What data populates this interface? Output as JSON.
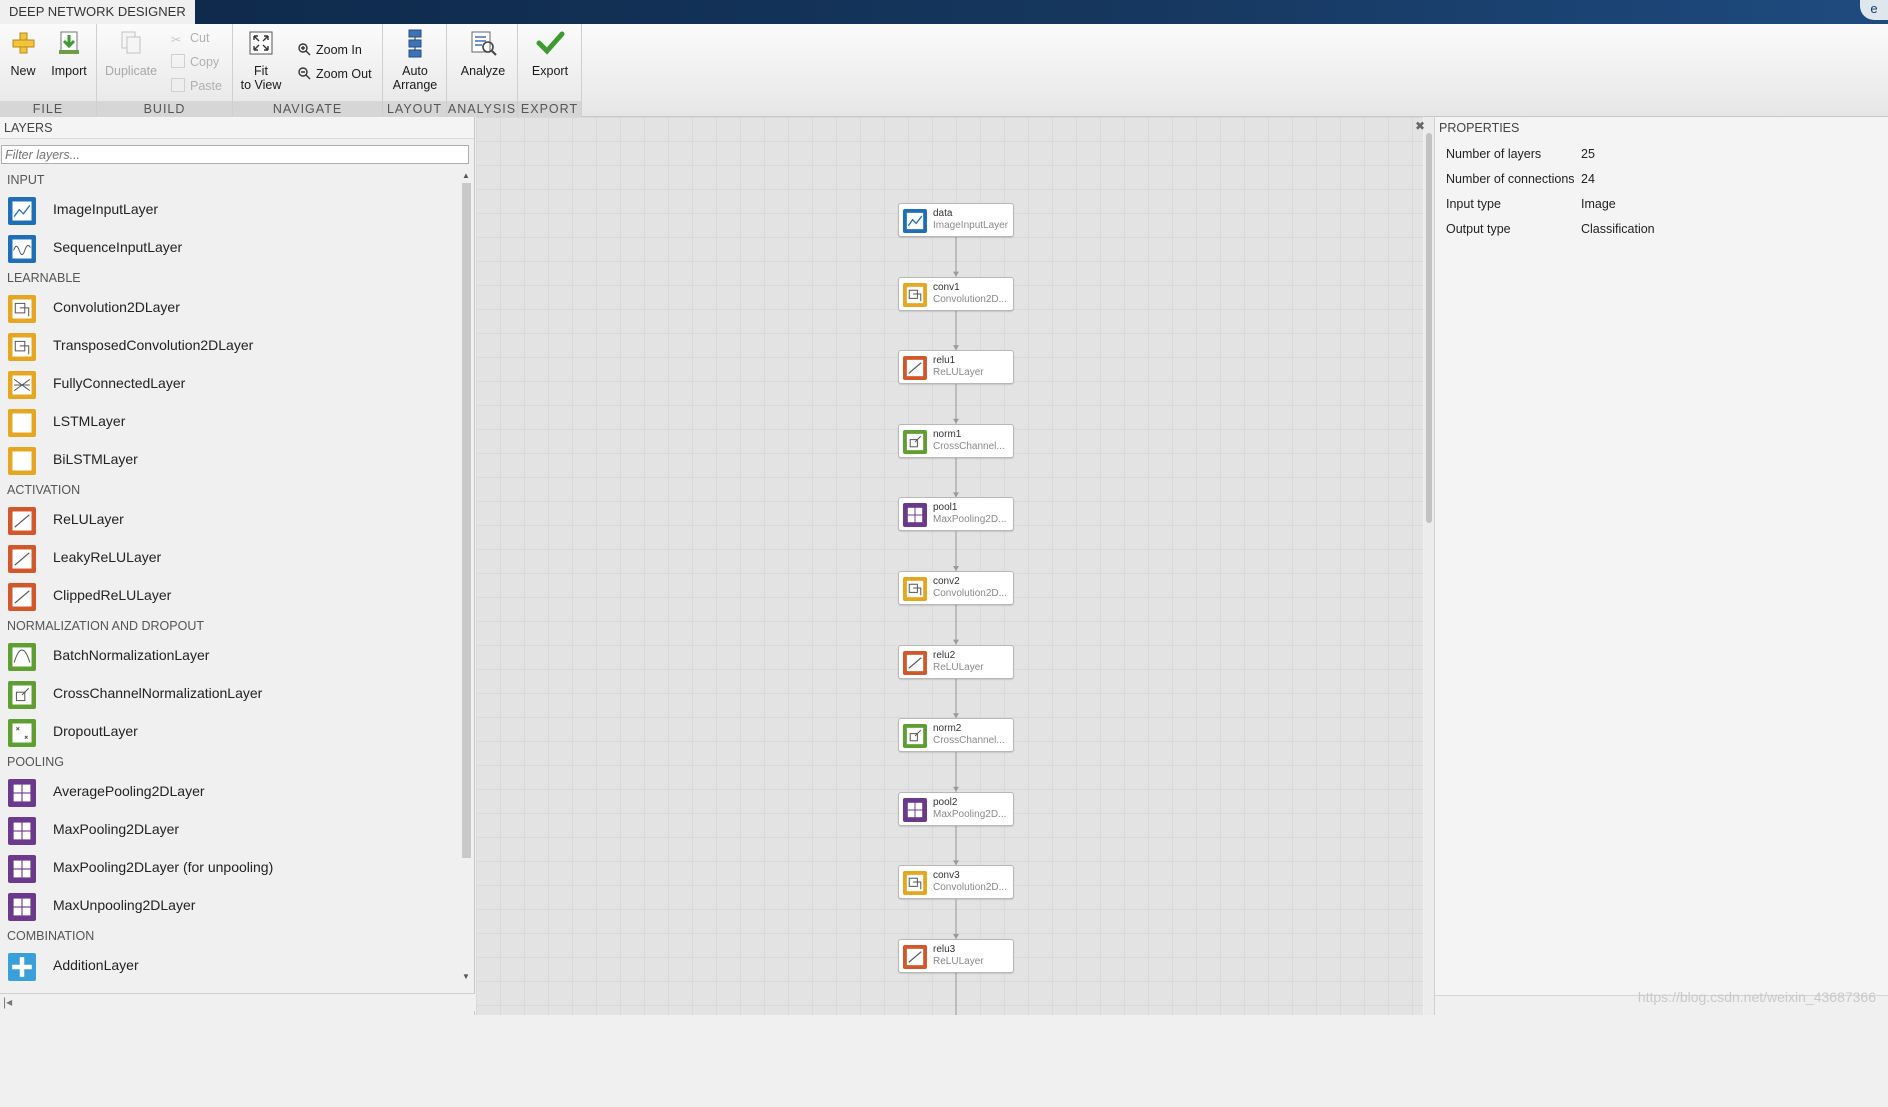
{
  "app": {
    "title": "DEEP NETWORK DESIGNER"
  },
  "ribbon": {
    "groups": {
      "file": "FILE",
      "build": "BUILD",
      "navigate": "NAVIGATE",
      "layout": "LAYOUT",
      "analysis": "ANALYSIS",
      "export": "EXPORT"
    },
    "buttons": {
      "new": "New",
      "import": "Import",
      "duplicate": "Duplicate",
      "cut": "Cut",
      "copy": "Copy",
      "paste": "Paste",
      "fit_line1": "Fit",
      "fit_line2": "to View",
      "zoom_in": "Zoom In",
      "zoom_out": "Zoom Out",
      "auto_line1": "Auto",
      "auto_line2": "Arrange",
      "analyze": "Analyze",
      "export": "Export"
    }
  },
  "layers_panel": {
    "header": "LAYERS",
    "filter_placeholder": "Filter layers...",
    "categories": [
      {
        "name": "INPUT",
        "items": [
          {
            "label": "ImageInputLayer",
            "icon": "image-input-icon"
          },
          {
            "label": "SequenceInputLayer",
            "icon": "sequence-input-icon"
          }
        ]
      },
      {
        "name": "LEARNABLE",
        "items": [
          {
            "label": "Convolution2DLayer",
            "icon": "convolution-icon"
          },
          {
            "label": "TransposedConvolution2DLayer",
            "icon": "transposed-convolution-icon"
          },
          {
            "label": "FullyConnectedLayer",
            "icon": "fully-connected-icon"
          },
          {
            "label": "LSTMLayer",
            "icon": "lstm-icon"
          },
          {
            "label": "BiLSTMLayer",
            "icon": "bilstm-icon"
          }
        ]
      },
      {
        "name": "ACTIVATION",
        "items": [
          {
            "label": "ReLULayer",
            "icon": "relu-icon"
          },
          {
            "label": "LeakyReLULayer",
            "icon": "leaky-relu-icon"
          },
          {
            "label": "ClippedReLULayer",
            "icon": "clipped-relu-icon"
          }
        ]
      },
      {
        "name": "NORMALIZATION AND DROPOUT",
        "items": [
          {
            "label": "BatchNormalizationLayer",
            "icon": "batch-norm-icon"
          },
          {
            "label": "CrossChannelNormalizationLayer",
            "icon": "cross-channel-norm-icon"
          },
          {
            "label": "DropoutLayer",
            "icon": "dropout-icon"
          }
        ]
      },
      {
        "name": "POOLING",
        "items": [
          {
            "label": "AveragePooling2DLayer",
            "icon": "average-pooling-icon"
          },
          {
            "label": "MaxPooling2DLayer",
            "icon": "max-pooling-icon"
          },
          {
            "label": "MaxPooling2DLayer (for unpooling)",
            "icon": "max-pooling-icon"
          },
          {
            "label": "MaxUnpooling2DLayer",
            "icon": "max-unpooling-icon"
          }
        ]
      },
      {
        "name": "COMBINATION",
        "items": [
          {
            "label": "AdditionLayer",
            "icon": "addition-icon"
          }
        ]
      }
    ]
  },
  "network": {
    "nodes": [
      {
        "name": "data",
        "type": "ImageInputLayer",
        "kind": "input"
      },
      {
        "name": "conv1",
        "type": "Convolution2D...",
        "kind": "conv"
      },
      {
        "name": "relu1",
        "type": "ReLULayer",
        "kind": "relu"
      },
      {
        "name": "norm1",
        "type": "CrossChannel...",
        "kind": "norm"
      },
      {
        "name": "pool1",
        "type": "MaxPooling2D...",
        "kind": "pool"
      },
      {
        "name": "conv2",
        "type": "Convolution2D...",
        "kind": "conv"
      },
      {
        "name": "relu2",
        "type": "ReLULayer",
        "kind": "relu"
      },
      {
        "name": "norm2",
        "type": "CrossChannel...",
        "kind": "norm"
      },
      {
        "name": "pool2",
        "type": "MaxPooling2D...",
        "kind": "pool"
      },
      {
        "name": "conv3",
        "type": "Convolution2D...",
        "kind": "conv"
      },
      {
        "name": "relu3",
        "type": "ReLULayer",
        "kind": "relu"
      }
    ]
  },
  "properties": {
    "header": "PROPERTIES",
    "rows": [
      {
        "key": "Number of layers",
        "value": "25"
      },
      {
        "key": "Number of connections",
        "value": "24"
      },
      {
        "key": "Input type",
        "value": "Image"
      },
      {
        "key": "Output type",
        "value": "Classification"
      }
    ],
    "watermark": "https://blog.csdn.net/weixin_43687366"
  },
  "colors": {
    "input": "#1f6eb8",
    "learnable": "#e7a620",
    "activation": "#d0582a",
    "normalization": "#5f9e31",
    "pooling": "#6b3a8c",
    "combination": "#3aa0db"
  }
}
